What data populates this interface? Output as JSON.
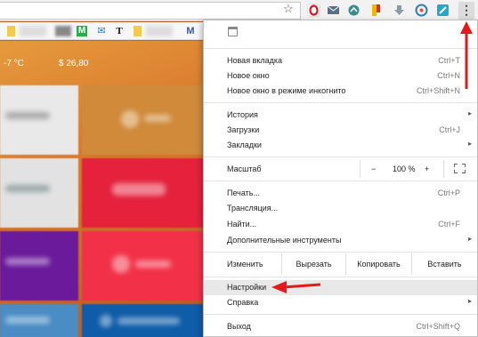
{
  "toolbar": {
    "star": "☆",
    "menu_dots": "⋮"
  },
  "bookmarks": [
    {
      "glyph": "M",
      "color": "#20b14a"
    },
    {
      "glyph": "✉",
      "color": "#2f73d8"
    },
    {
      "glyph": "T",
      "color": "#111111"
    },
    {
      "glyph": "M",
      "color": "#3b5998"
    }
  ],
  "page": {
    "weather": "-7 °C",
    "rate": "$ 26,80"
  },
  "menu": {
    "new_tab": {
      "label": "Новая вкладка",
      "shortcut": "Ctrl+T"
    },
    "new_window": {
      "label": "Новое окно",
      "shortcut": "Ctrl+N"
    },
    "incognito": {
      "label": "Новое окно в режиме инкогнито",
      "shortcut": "Ctrl+Shift+N"
    },
    "history": {
      "label": "История"
    },
    "downloads": {
      "label": "Загрузки",
      "shortcut": "Ctrl+J"
    },
    "bookmarks": {
      "label": "Закладки"
    },
    "zoom": {
      "label": "Масштаб",
      "minus": "−",
      "value": "100 %",
      "plus": "+"
    },
    "print": {
      "label": "Печать...",
      "shortcut": "Ctrl+P"
    },
    "cast": {
      "label": "Трансляция..."
    },
    "find": {
      "label": "Найти...",
      "shortcut": "Ctrl+F"
    },
    "more_tools": {
      "label": "Дополнительные инструменты"
    },
    "edit": {
      "label": "Изменить",
      "cut": "Вырезать",
      "copy": "Копировать",
      "paste": "Вставить"
    },
    "settings": {
      "label": "Настройки"
    },
    "help": {
      "label": "Справка"
    },
    "exit": {
      "label": "Выход",
      "shortcut": "Ctrl+Shift+Q"
    },
    "submenu_arrow": "▸"
  },
  "colors": {
    "annotation": "#e3191c",
    "highlight": "#e8e8e8"
  }
}
